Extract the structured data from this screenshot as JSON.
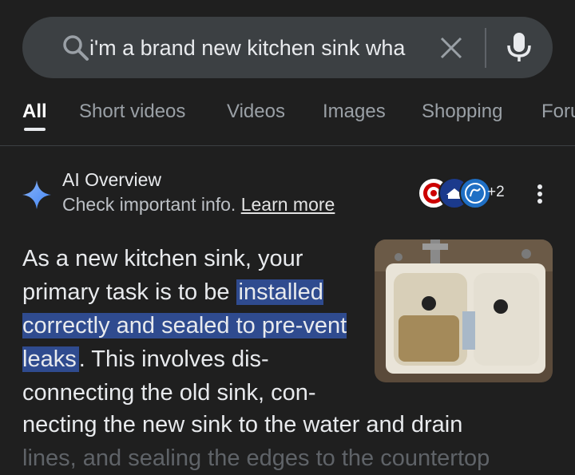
{
  "search": {
    "query": "i'm a brand new kitchen sink wha"
  },
  "tabs": [
    {
      "label": "All",
      "active": true
    },
    {
      "label": "Short videos"
    },
    {
      "label": "Videos"
    },
    {
      "label": "Images"
    },
    {
      "label": "Shopping"
    },
    {
      "label": "Foru"
    }
  ],
  "ai_overview": {
    "title": "AI Overview",
    "subtitle": "Check important info.",
    "learn_more": "Learn more",
    "sources_extra": "+2",
    "body_prefix": "As a new kitchen sink, your primary task is to be ",
    "body_highlight": "installed correctly and sealed to pre-vent leaks",
    "body_after": ". This involves dis-connecting the old sink, con-",
    "body_line_full": "necting the new sink to the water and drain",
    "body_faded": "lines, and sealing the edges to the countertop"
  },
  "colors": {
    "background": "#1f1f1f",
    "search_bg": "#3c4043",
    "highlight": "#2f4b8f"
  }
}
